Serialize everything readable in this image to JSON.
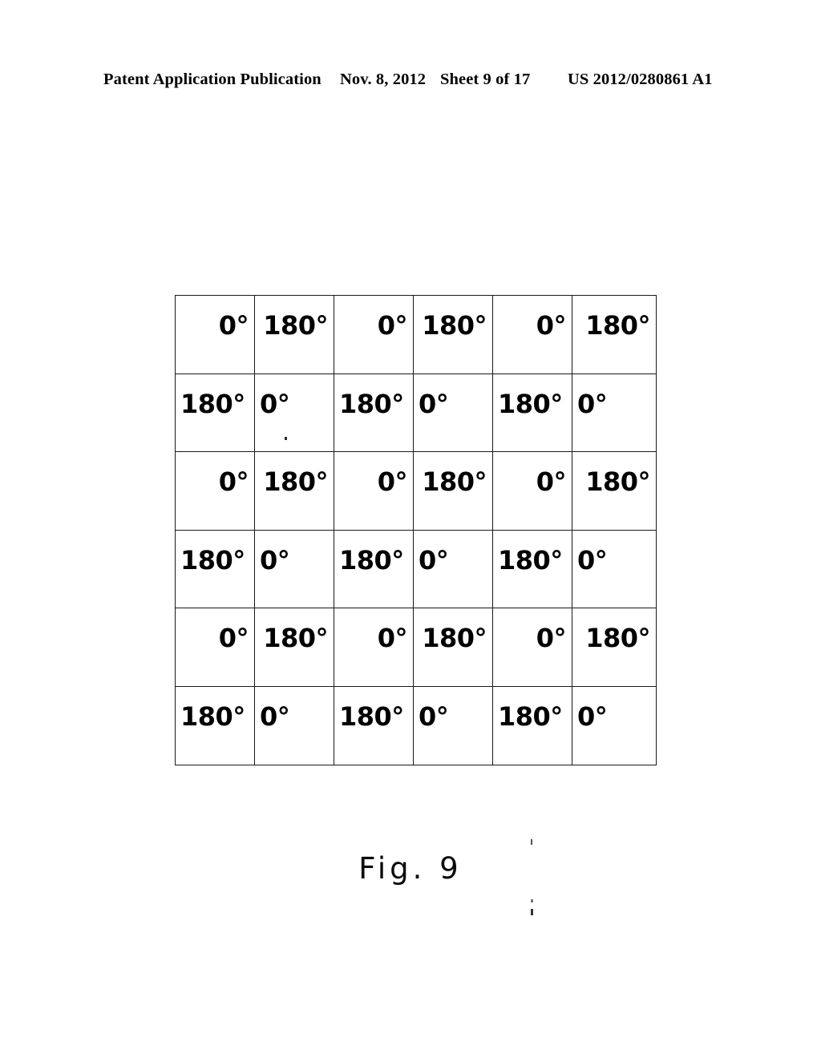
{
  "header": {
    "publication": "Patent Application Publication",
    "date": "Nov. 8, 2012",
    "sheet": "Sheet 9 of 17",
    "patent_number": "US 2012/0280861 A1"
  },
  "figure": {
    "caption": "Fig. 9",
    "grid": {
      "rows": 6,
      "columns": 6,
      "values": [
        [
          "0°",
          "180°",
          "0°",
          "180°",
          "0°",
          "180°"
        ],
        [
          "180°",
          "0°",
          "180°",
          "0°",
          "180°",
          "0°"
        ],
        [
          "0°",
          "180°",
          "0°",
          "180°",
          "0°",
          "180°"
        ],
        [
          "180°",
          "0°",
          "180°",
          "0°",
          "180°",
          "0°"
        ],
        [
          "0°",
          "180°",
          "0°",
          "180°",
          "0°",
          "180°"
        ],
        [
          "180°",
          "0°",
          "180°",
          "0°",
          "180°",
          "0°"
        ]
      ]
    }
  },
  "colors": {
    "ink": "#000000",
    "grid_line": "#1a1a1a",
    "page_background": "#ffffff"
  }
}
